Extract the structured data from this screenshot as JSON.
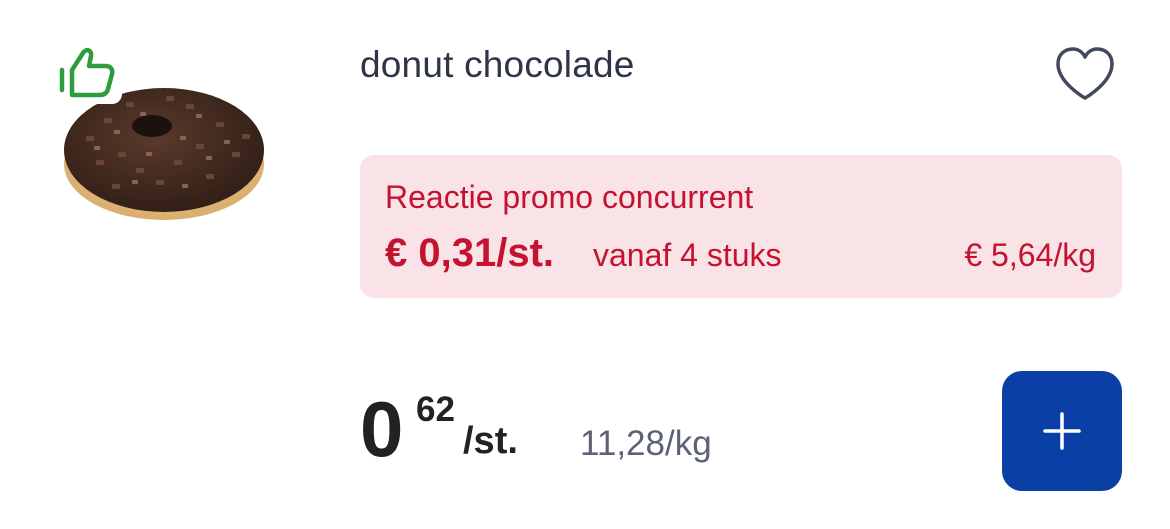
{
  "product": {
    "name": "donut chocolade",
    "image": "chocolate-sprinkle-donut",
    "badge_icon": "thumbs-up-icon",
    "favorite_icon": "heart-outline-icon"
  },
  "promo": {
    "label": "Reactie promo concurrent",
    "price": "€ 0,31/st.",
    "condition": "vanaf 4 stuks",
    "unit_price": "€ 5,64/kg"
  },
  "pricing": {
    "whole": "0",
    "cents": "62",
    "unit": "/st.",
    "per_kg": "11,28/kg"
  },
  "actions": {
    "add_icon": "plus-icon"
  },
  "colors": {
    "promo_text": "#c41230",
    "promo_background": "#fae3e6",
    "add_button": "#0a3fa6",
    "thumb_icon": "#2e9c3c"
  }
}
